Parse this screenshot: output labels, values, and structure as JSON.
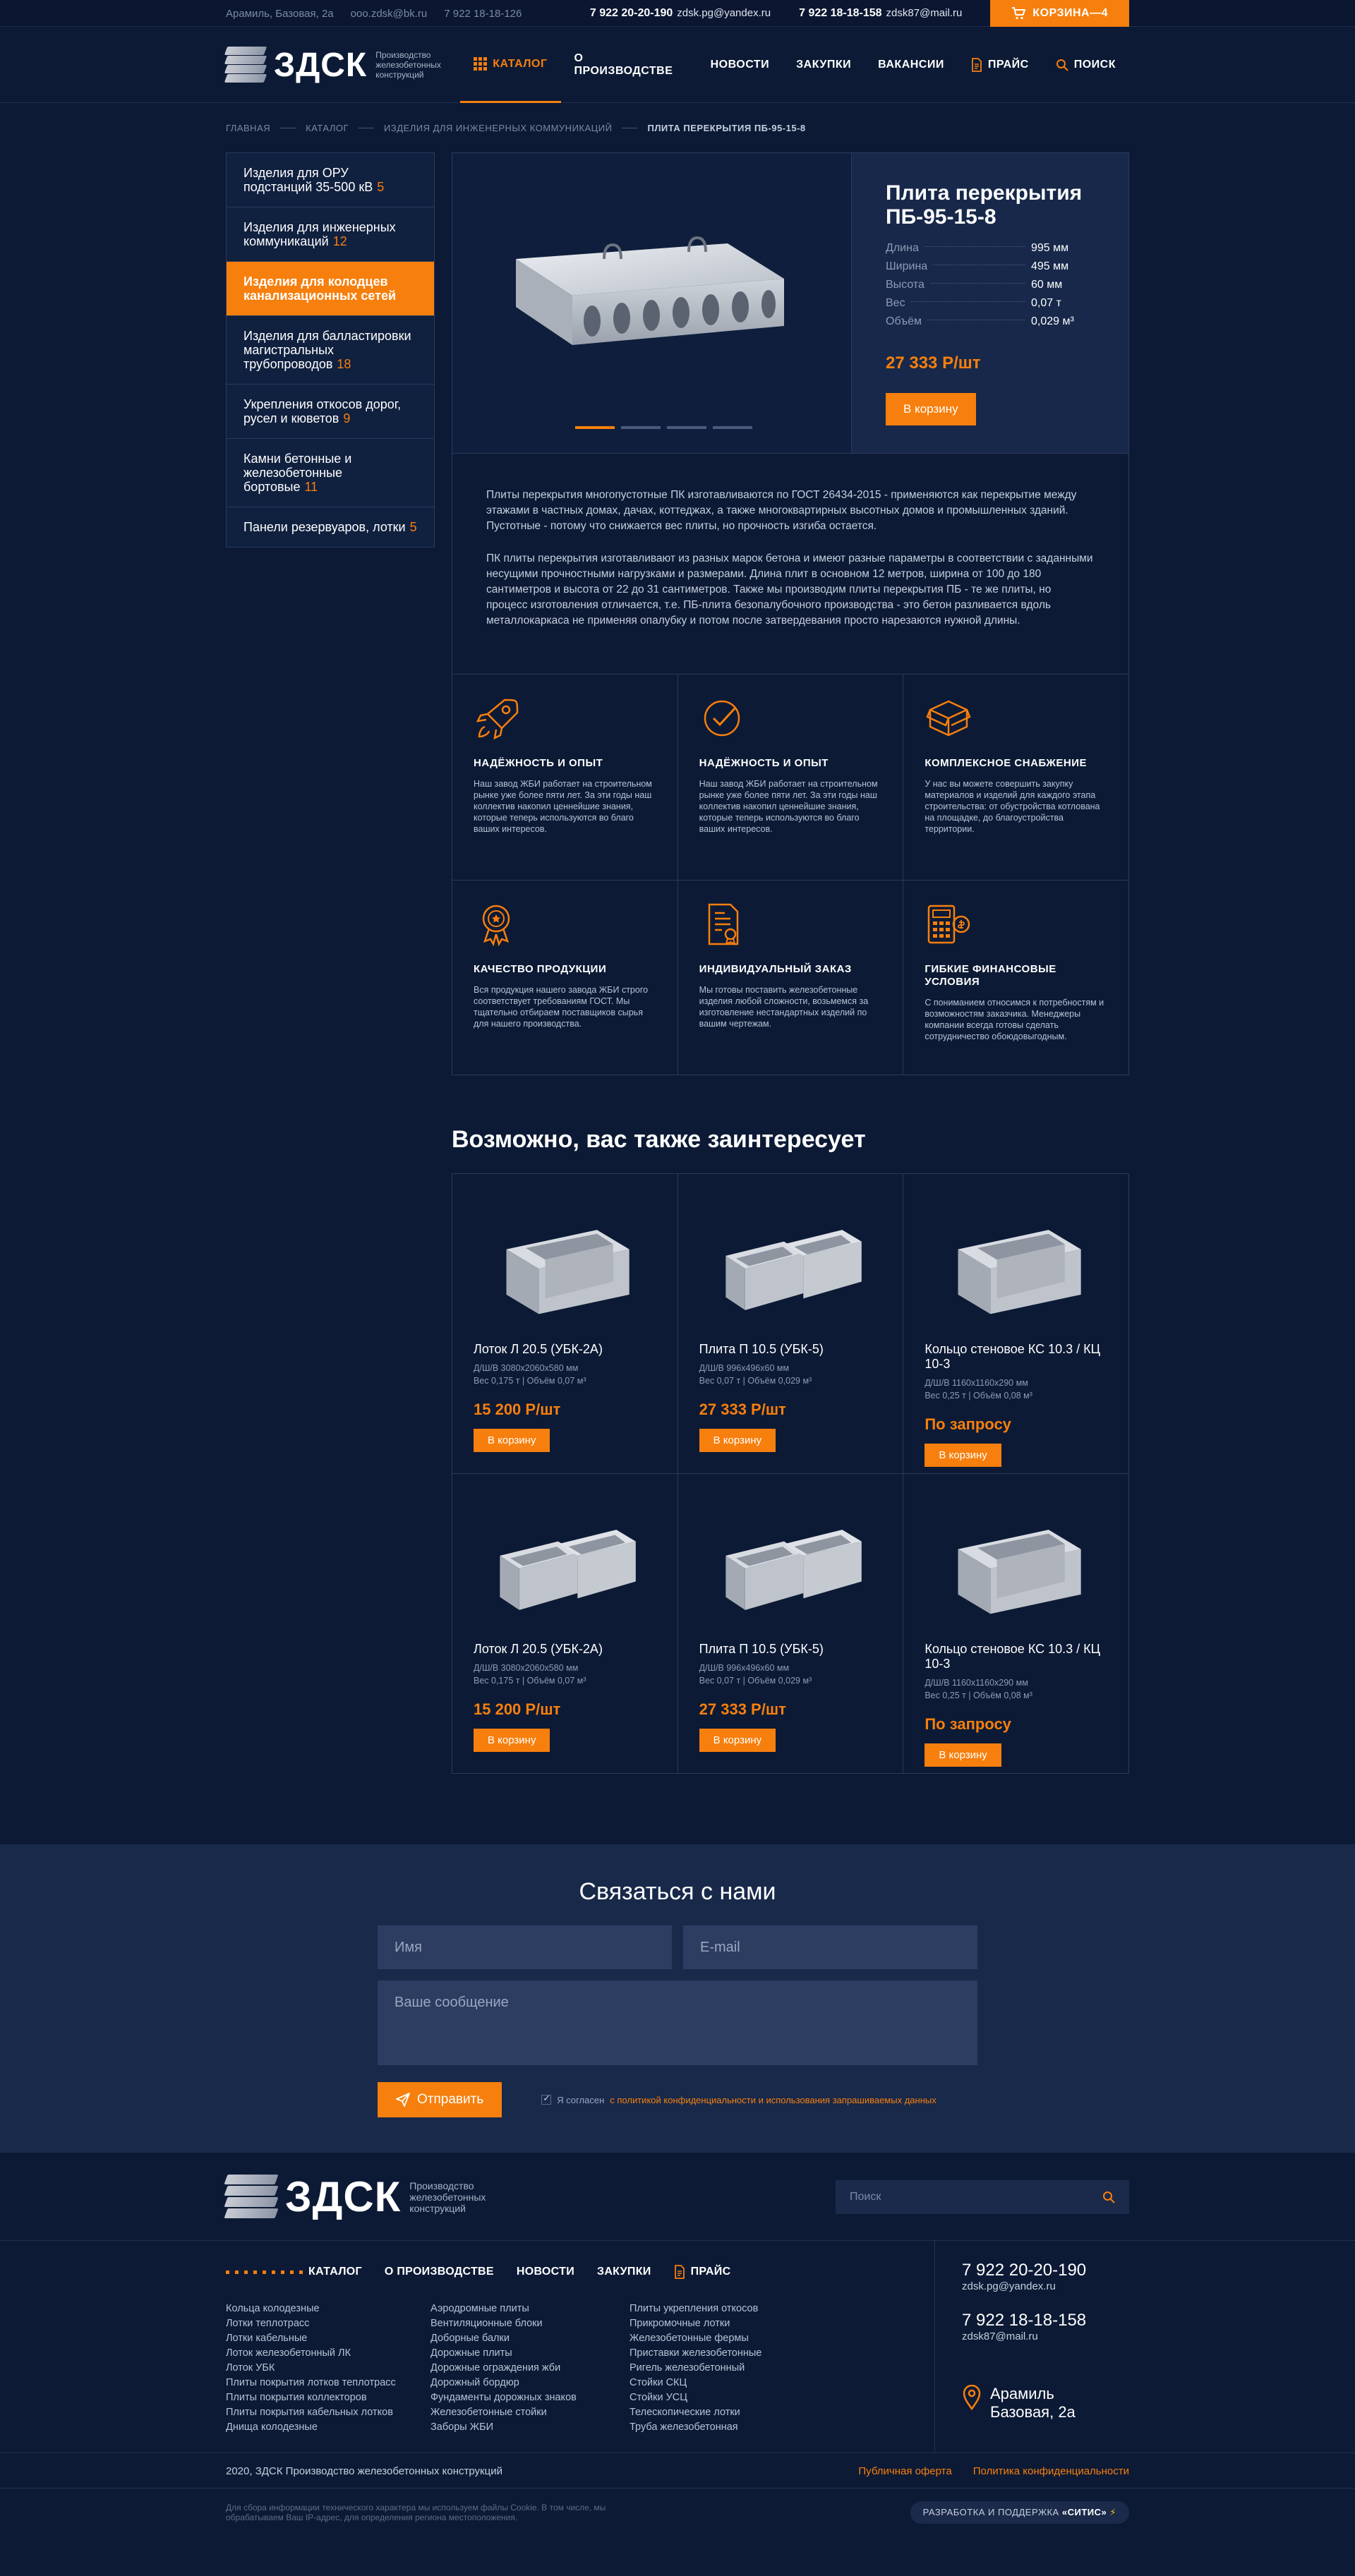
{
  "topbar": {
    "address": "Арамиль, Базовая, 2а",
    "email": "ooo.zdsk@bk.ru",
    "phone_small": "7 922 18-18-126",
    "phone1": "7 922 20-20-190",
    "email1": "zdsk.pg@yandex.ru",
    "phone2": "7 922 18-18-158",
    "email2": "zdsk87@mail.ru",
    "cart_label": "КОРЗИНА—4"
  },
  "logo": {
    "text": "ЗДСК",
    "sub": "Производство железобетонных конструкций"
  },
  "nav": [
    {
      "label": "КАТАЛОГ"
    },
    {
      "label": "О ПРОИЗВОДСТВЕ"
    },
    {
      "label": "НОВОСТИ"
    },
    {
      "label": "ЗАКУПКИ"
    },
    {
      "label": "ВАКАНСИИ"
    },
    {
      "label": "ПРАЙС"
    },
    {
      "label": "ПОИСК"
    }
  ],
  "breadcrumbs": [
    "ГЛАВНАЯ",
    "КАТАЛОГ",
    "ИЗДЕЛИЯ ДЛЯ ИНЖЕНЕРНЫХ КОММУНИКАЦИЙ",
    "ПЛИТА ПЕРЕКРЫТИЯ ПБ-95-15-8"
  ],
  "sidebar": [
    {
      "label": "Изделия для ОРУ подстанций 35-500 кВ",
      "count": "5"
    },
    {
      "label": "Изделия для инженерных коммуникаций",
      "count": "12"
    },
    {
      "label": "Изделия для колодцев канализационных сетей",
      "count": ""
    },
    {
      "label": "Изделия для балластировки магистральных трубопроводов",
      "count": "18"
    },
    {
      "label": "Укрепления откосов дорог, русел и кюветов",
      "count": "9"
    },
    {
      "label": "Камни бетонные и железобетонные бортовые",
      "count": "11"
    },
    {
      "label": "Панели резервуаров, лотки",
      "count": "5"
    }
  ],
  "product": {
    "title": "Плита перекрытия ПБ-95-15-8",
    "specs": [
      {
        "k": "Длина",
        "v": "995 мм"
      },
      {
        "k": "Ширина",
        "v": "495 мм"
      },
      {
        "k": "Высота",
        "v": "60 мм"
      },
      {
        "k": "Вес",
        "v": "0,07 т"
      },
      {
        "k": "Объём",
        "v": "0,029 м³"
      }
    ],
    "price": "27 333 Р/шт",
    "cart_btn": "В корзину"
  },
  "description": [
    "Плиты перекрытия многопустотные ПК изготавливаются по ГОСТ 26434-2015 - применяются как перекрытие между этажами в частных домах, дачах, коттеджах, а также многоквартирных высотных домов и промышленных зданий. Пустотные - потому что снижается вес плиты, но прочность изгиба остается.",
    "ПК плиты перекрытия изготавливают из разных марок бетона и имеют разные параметры в соответствии с заданными несущими прочностными нагрузками и размерами. Длина плит в основном 12 метров, ширина от 100 до 180 сантиметров и высота от 22 до 31 сантиметров. Также мы производим плиты перекрытия ПБ - те же плиты, но процесс изготовления отличается, т.е. ПБ-плита безопалубочного производства - это бетон разливается вдоль металлокаркаса не применяя опалубку и потом после затвердевания просто нарезаются нужной длины."
  ],
  "features": [
    {
      "icon": "rocket-icon",
      "title": "НАДЁЖНОСТЬ И ОПЫТ",
      "text": "Наш завод ЖБИ работает на строительном рынке уже более пяти лет. За эти годы наш коллектив накопил ценнейшие знания, которые теперь используются во благо ваших интересов."
    },
    {
      "icon": "check-circle-icon",
      "title": "НАДЁЖНОСТЬ И ОПЫТ",
      "text": "Наш завод ЖБИ работает на строительном рынке уже более пяти лет. За эти годы наш коллектив накопил ценнейшие знания, которые теперь используются во благо ваших интересов."
    },
    {
      "icon": "box-icon",
      "title": "КОМПЛЕКСНОЕ СНАБЖЕНИЕ",
      "text": "У нас вы можете совершить закупку материалов и изделий для каждого этапа строительства: от обустройства котлована на площадке, до благоустройства территории."
    },
    {
      "icon": "medal-icon",
      "title": "КАЧЕСТВО ПРОДУКЦИИ",
      "text": "Вся продукция нашего завода ЖБИ строго соответствует требованиям ГОСТ. Мы тщательно отбираем поставщиков сырья для нашего производства."
    },
    {
      "icon": "document-icon",
      "title": "ИНДИВИДУАЛЬНЫЙ ЗАКАЗ",
      "text": "Мы готовы поставить железобетонные изделия любой сложности, возьмемся за изготовление нестандартных изделий по вашим чертежам."
    },
    {
      "icon": "calculator-icon",
      "title": "ГИБКИЕ ФИНАНСОВЫЕ УСЛОВИЯ",
      "text": "С пониманием относимся к потребностям и возможностям заказчика. Менеджеры компании всегда готовы сделать сотрудничество обоюдовыгодным."
    }
  ],
  "related_title": "Возможно, вас также заинтересует",
  "related": [
    {
      "img": "u-channel",
      "title": "Лоток Л 20.5 (УБК-2А)",
      "dims": "Д/Ш/В 3080х2060х580 мм",
      "meta": "Вес 0,175 т  |  Объём 0,07 м³",
      "price": "15 200 Р/шт",
      "btn": "В корзину"
    },
    {
      "img": "double-channel",
      "title": "Плита П 10.5 (УБК-5)",
      "dims": "Д/Ш/В 996х496х60 мм",
      "meta": "Вес 0,07 т  |  Объём 0,029 м³",
      "price": "27 333 Р/шт",
      "btn": "В корзину"
    },
    {
      "img": "u-channel",
      "title": "Кольцо стеновое КС 10.3 / КЦ 10-3",
      "dims": "Д/Ш/В 1160х1160х290 мм",
      "meta": "Вес 0,25 т  |  Объём 0,08 м³",
      "price": "По запросу",
      "btn": "В корзину"
    },
    {
      "img": "double-channel",
      "title": "Лоток Л 20.5 (УБК-2А)",
      "dims": "Д/Ш/В 3080х2060х580 мм",
      "meta": "Вес 0,175 т  |  Объём 0,07 м³",
      "price": "15 200 Р/шт",
      "btn": "В корзину"
    },
    {
      "img": "double-channel",
      "title": "Плита П 10.5 (УБК-5)",
      "dims": "Д/Ш/В 996х496х60 мм",
      "meta": "Вес 0,07 т  |  Объём 0,029 м³",
      "price": "27 333 Р/шт",
      "btn": "В корзину"
    },
    {
      "img": "u-channel",
      "title": "Кольцо стеновое КС 10.3 / КЦ 10-3",
      "dims": "Д/Ш/В 1160х1160х290 мм",
      "meta": "Вес 0,25 т  |  Объём 0,08 м³",
      "price": "По запросу",
      "btn": "В корзину"
    }
  ],
  "contact": {
    "title": "Связаться с нами",
    "name_placeholder": "Имя",
    "email_placeholder": "E-mail",
    "message_placeholder": "Ваше сообщение",
    "send": "Отправить",
    "agree_prefix": "Я согласен",
    "agree_link": "с политикой конфиденциальности и использования запрашиваемых данных"
  },
  "footer": {
    "search_placeholder": "Поиск",
    "nav": [
      "КАТАЛОГ",
      "О ПРОИЗВОДСТВЕ",
      "НОВОСТИ",
      "ЗАКУПКИ",
      "ПРАЙС"
    ],
    "col1": [
      "Кольца колодезные",
      "Лотки теплотрасс",
      "Лотки кабельные",
      "Лоток железобетонный ЛК",
      "Лоток УБК",
      "Плиты покрытия лотков теплотрасс",
      "Плиты покрытия коллекторов",
      "Плиты покрытия кабельных лотков",
      "Днища колодезные"
    ],
    "col2": [
      "Аэродромные плиты",
      "Вентиляционные блоки",
      "Доборные балки",
      "Дорожные плиты",
      "Дорожные ограждения жби",
      "Дорожный бордюр",
      "Фундаменты дорожных знаков",
      "Железобетонные стойки",
      "Заборы ЖБИ"
    ],
    "col3": [
      "Плиты укрепления откосов",
      "Прикромочные лотки",
      "Железобетонные фермы",
      "Приставки железобетонные",
      "Ригель железобетонный",
      "Стойки СКЦ",
      "Стойки УСЦ",
      "Телескопические лотки",
      "Труба железобетонная"
    ],
    "phone1": "7 922 20-20-190",
    "email1": "zdsk.pg@yandex.ru",
    "phone2": "7 922 18-18-158",
    "email2": "zdsk87@mail.ru",
    "address": "Арамиль Базовая, 2а",
    "copyright": "2020, ЗДСК Производство железобетонных конструкций",
    "offer": "Публичная оферта",
    "privacy": "Политика конфиденциальности",
    "legal": "Для сбора информации технического характера мы используем файлы Cookie. В том числе, мы обрабатываем Ваш IP-адрес, для определения региона местоположения.",
    "dev_prefix": "РАЗРАБОТКА И ПОДДЕРЖКА",
    "dev_name": "«СИТИС»"
  }
}
